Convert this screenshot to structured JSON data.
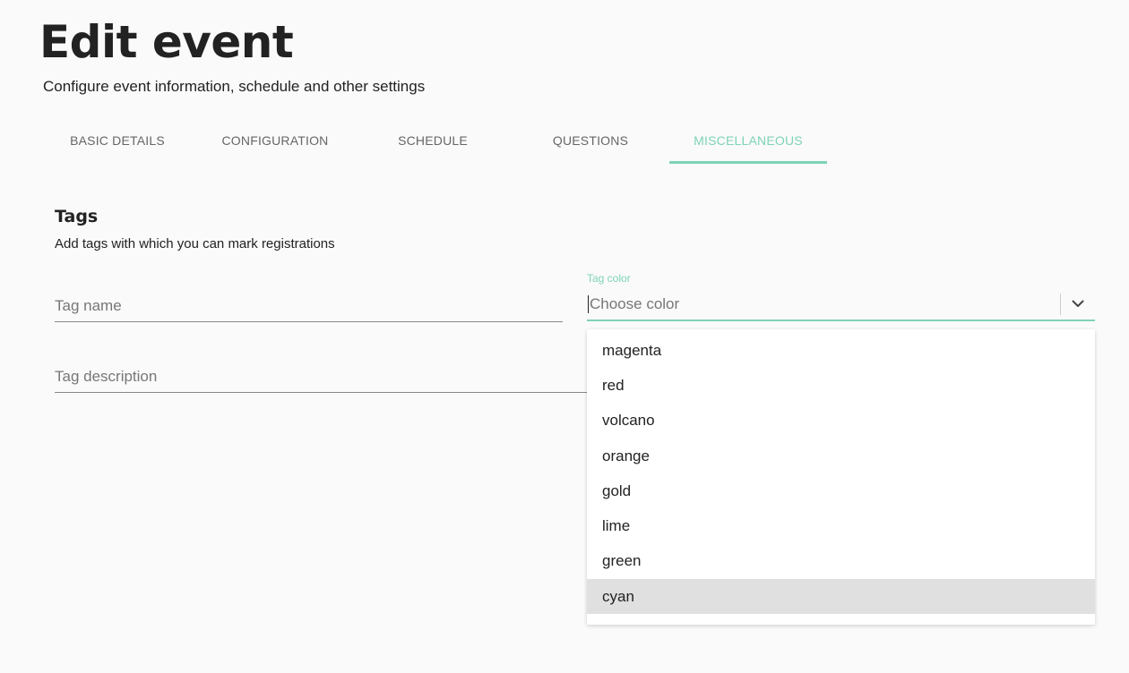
{
  "header": {
    "title": "Edit event",
    "subtitle": "Configure event information, schedule and other settings"
  },
  "tabs": [
    {
      "label": "BASIC DETAILS",
      "active": false
    },
    {
      "label": "CONFIGURATION",
      "active": false
    },
    {
      "label": "SCHEDULE",
      "active": false
    },
    {
      "label": "QUESTIONS",
      "active": false
    },
    {
      "label": "MISCELLANEOUS",
      "active": true
    }
  ],
  "tags_section": {
    "title": "Tags",
    "description": "Add tags with which you can mark registrations",
    "tag_name": {
      "value": "",
      "placeholder": "Tag name"
    },
    "tag_description": {
      "value": "",
      "placeholder": "Tag description"
    },
    "tag_color": {
      "label": "Tag color",
      "placeholder": "Choose color",
      "icon": "chevron-down-icon",
      "options": [
        "magenta",
        "red",
        "volcano",
        "orange",
        "gold",
        "lime",
        "green",
        "cyan"
      ],
      "highlighted_option": "cyan"
    }
  },
  "colors": {
    "accent": "#7ed3b6",
    "background": "#fafafa",
    "highlight": "#e0e0e0"
  }
}
